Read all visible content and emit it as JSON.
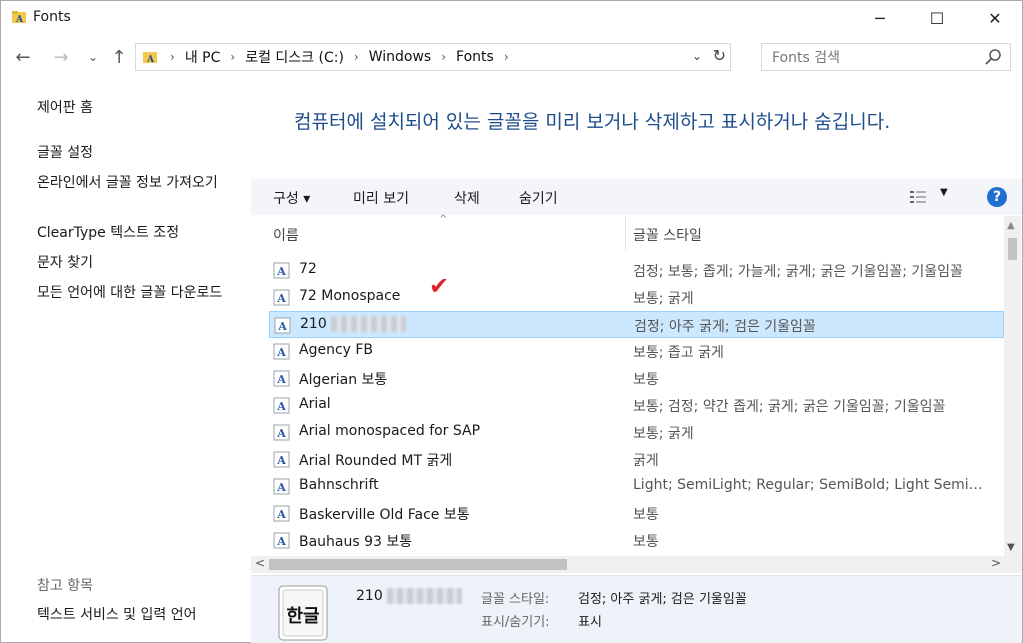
{
  "window": {
    "title": "Fonts",
    "minimize": "─",
    "maximize": "☐",
    "close": "✕"
  },
  "nav": {
    "back": "←",
    "forward": "→",
    "recent": "⌄",
    "up": "↑",
    "breadcrumbs": [
      "내 PC",
      "로컬 디스크 (C:)",
      "Windows",
      "Fonts"
    ],
    "separator": "›",
    "dropdown": "⌄",
    "refresh": "↻"
  },
  "search": {
    "placeholder": "Fonts 검색"
  },
  "sidebar": {
    "home": "제어판 홈",
    "links": [
      "글꼴 설정",
      "온라인에서 글꼴 정보 가져오기",
      "ClearType 텍스트 조정",
      "문자 찾기",
      "모든 언어에 대한 글꼴 다운로드"
    ],
    "see_also": "참고 항목",
    "see_also_links": [
      "텍스트 서비스 및 입력 언어"
    ]
  },
  "main": {
    "title": "컴퓨터에 설치되어 있는 글꼴을 미리 보거나 삭제하고 표시하거나 숨깁니다."
  },
  "toolbar": {
    "organize": "구성 ▾",
    "preview": "미리 보기",
    "delete": "삭제",
    "hide": "숨기기",
    "view_arrow": "▼",
    "help": "?"
  },
  "columns": {
    "name": "이름",
    "style": "글꼴 스타일",
    "sort_caret": "^"
  },
  "fonts": [
    {
      "name": "72",
      "style": "검정; 보통; 좁게; 가늘게; 굵게; 굵은 기울임꼴; 기울임꼴",
      "selected": false
    },
    {
      "name": "72 Monospace",
      "style": "보통; 굵게",
      "selected": false
    },
    {
      "name": "210",
      "style": "검정; 아주 굵게; 검은 기울임꼴",
      "selected": true,
      "blurred": true
    },
    {
      "name": "Agency FB",
      "style": "보통; 좁고 굵게",
      "selected": false
    },
    {
      "name": "Algerian 보통",
      "style": "보통",
      "selected": false
    },
    {
      "name": "Arial",
      "style": "보통; 검정; 약간 좁게; 굵게; 굵은 기울임꼴; 기울임꼴",
      "selected": false
    },
    {
      "name": "Arial monospaced for SAP",
      "style": "보통; 굵게",
      "selected": false
    },
    {
      "name": "Arial Rounded MT 굵게",
      "style": "굵게",
      "selected": false
    },
    {
      "name": "Bahnschrift",
      "style": "Light; SemiLight; Regular; SemiBold; Light SemiCondensed",
      "selected": false
    },
    {
      "name": "Baskerville Old Face 보통",
      "style": "보통",
      "selected": false
    },
    {
      "name": "Bauhaus 93 보통",
      "style": "보통",
      "selected": false
    }
  ],
  "checkmark": "✔",
  "scroll": {
    "up": "▲",
    "down": "▼",
    "left": "<",
    "right": ">"
  },
  "details": {
    "icon_text": "한글",
    "name": "210",
    "style_label": "글꼴 스타일:",
    "style_value": "검정; 아주 굵게; 검은 기울임꼴",
    "visibility_label": "표시/숨기기:",
    "visibility_value": "표시"
  },
  "colors": {
    "accent": "#1e4d8c",
    "selection": "#cce8ff",
    "help": "#1f6fd1",
    "check": "#e0202a"
  }
}
